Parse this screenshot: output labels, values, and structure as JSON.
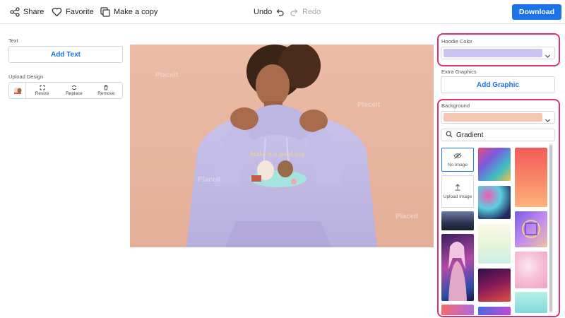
{
  "toolbar": {
    "share_label": "Share",
    "favorite_label": "Favorite",
    "copy_label": "Make a copy",
    "undo_label": "Undo",
    "redo_label": "Redo",
    "download_label": "Download"
  },
  "left_panel": {
    "text_section_label": "Text",
    "add_text_label": "Add Text",
    "upload_section_label": "Upload Design",
    "resize_label": "Resize",
    "replace_label": "Replace",
    "remove_label": "Remove"
  },
  "right_panel": {
    "hoodie_color_label": "Hoodie Color",
    "hoodie_color_value": "#cbc4ee",
    "extra_graphics_label": "Extra Graphics",
    "add_graphic_label": "Add Graphic",
    "background_label": "Background",
    "background_color_value": "#f6c6b3",
    "search_value": "Gradient",
    "no_image_label": "No Image",
    "upload_image_label": "Upload Image"
  },
  "mockup": {
    "watermark": "Placeit"
  },
  "colors": {
    "accent": "#1a73e8",
    "highlight": "#e0316f",
    "canvas_background": "#e9b7a2",
    "hoodie": "#c4bde6"
  }
}
